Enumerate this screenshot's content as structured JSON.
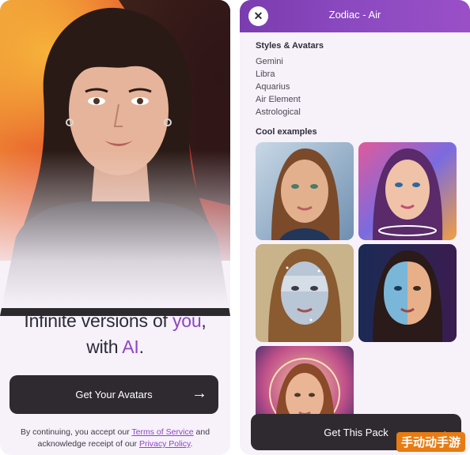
{
  "left_screen": {
    "headline_line1_prefix": "Infinite versions of ",
    "headline_line1_accent": "you",
    "headline_line1_suffix": ",",
    "headline_line2_prefix": "with ",
    "headline_line2_accent": "AI",
    "headline_line2_suffix": ".",
    "cta_label": "Get Your Avatars",
    "arrow_icon": "→",
    "legal_line1_prefix": "By continuing, you accept our ",
    "terms_link": "Terms of Service",
    "legal_line1_suffix": " and",
    "legal_line2_prefix": "acknowledge receipt of our ",
    "privacy_link": "Privacy Policy",
    "legal_line2_suffix": ".",
    "accent_color": "#8e45c7"
  },
  "right_screen": {
    "title": "Zodiac - Air",
    "close_icon": "✕",
    "styles_heading": "Styles & Avatars",
    "styles": [
      "Gemini",
      "Libra",
      "Aquarius",
      "Air Element",
      "Astrological"
    ],
    "examples_heading": "Cool examples",
    "pack_button_label": "Get This Pack",
    "arrow_icon": "→",
    "header_color": "#8646bb"
  },
  "watermark": "手动动手游"
}
